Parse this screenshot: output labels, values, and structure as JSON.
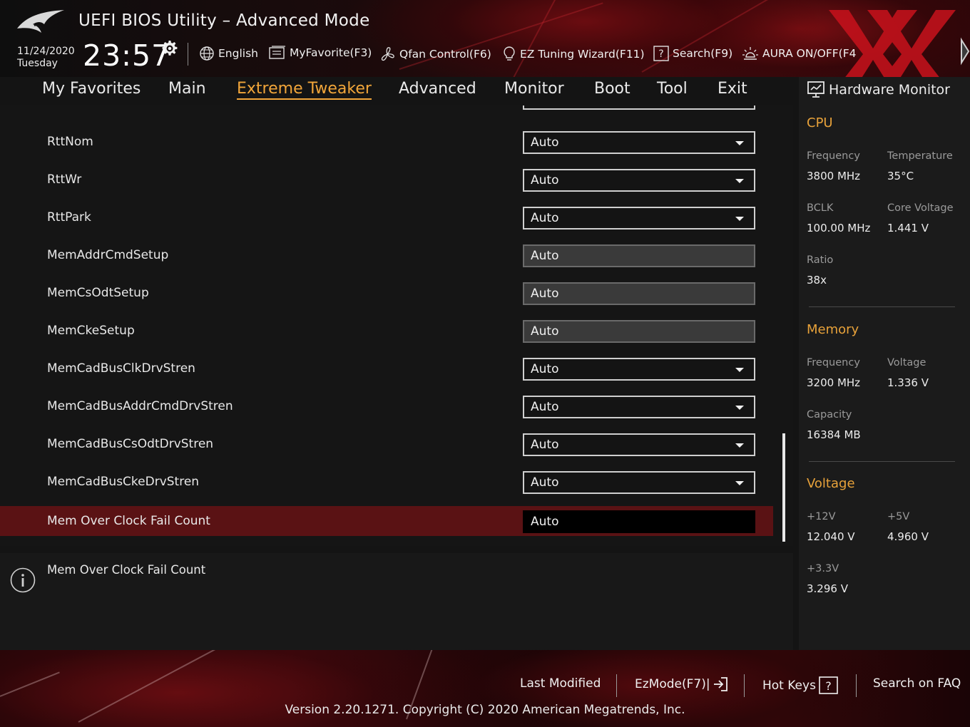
{
  "header": {
    "title": "UEFI BIOS Utility – Advanced Mode",
    "date": "11/24/2020",
    "day": "Tuesday",
    "time": "23:57",
    "toolbar": {
      "language": "English",
      "myfavorite": "MyFavorite(F3)",
      "qfan": "Qfan Control(F6)",
      "ez_tuning": "EZ Tuning Wizard(F11)",
      "search": "Search(F9)",
      "aura": "AURA ON/OFF(F4"
    }
  },
  "nav": {
    "tabs": [
      "My Favorites",
      "Main",
      "Extreme Tweaker",
      "Advanced",
      "Monitor",
      "Boot",
      "Tool",
      "Exit"
    ],
    "active": "Extreme Tweaker"
  },
  "settings": [
    {
      "label": "RttNom",
      "value": "Auto",
      "type": "dropdown"
    },
    {
      "label": "RttWr",
      "value": "Auto",
      "type": "dropdown"
    },
    {
      "label": "RttPark",
      "value": "Auto",
      "type": "dropdown"
    },
    {
      "label": "MemAddrCmdSetup",
      "value": "Auto",
      "type": "readonly"
    },
    {
      "label": "MemCsOdtSetup",
      "value": "Auto",
      "type": "readonly"
    },
    {
      "label": "MemCkeSetup",
      "value": "Auto",
      "type": "readonly"
    },
    {
      "label": "MemCadBusClkDrvStren",
      "value": "Auto",
      "type": "dropdown"
    },
    {
      "label": "MemCadBusAddrCmdDrvStren",
      "value": "Auto",
      "type": "dropdown"
    },
    {
      "label": "MemCadBusCsOdtDrvStren",
      "value": "Auto",
      "type": "dropdown"
    },
    {
      "label": "MemCadBusCkeDrvStren",
      "value": "Auto",
      "type": "dropdown"
    },
    {
      "label": "Mem Over Clock Fail Count",
      "value": "Auto",
      "type": "input",
      "selected": true
    }
  ],
  "info": {
    "text": "Mem Over Clock Fail Count"
  },
  "hw_monitor": {
    "title": "Hardware Monitor",
    "cpu": {
      "heading": "CPU",
      "frequency_label": "Frequency",
      "frequency": "3800 MHz",
      "temperature_label": "Temperature",
      "temperature": "35°C",
      "bclk_label": "BCLK",
      "bclk": "100.00 MHz",
      "core_voltage_label": "Core Voltage",
      "core_voltage": "1.441 V",
      "ratio_label": "Ratio",
      "ratio": "38x"
    },
    "memory": {
      "heading": "Memory",
      "frequency_label": "Frequency",
      "frequency": "3200 MHz",
      "voltage_label": "Voltage",
      "voltage": "1.336 V",
      "capacity_label": "Capacity",
      "capacity": "16384 MB"
    },
    "voltage": {
      "heading": "Voltage",
      "v12_label": "+12V",
      "v12": "12.040 V",
      "v5_label": "+5V",
      "v5": "4.960 V",
      "v33_label": "+3.3V",
      "v33": "3.296 V"
    }
  },
  "footer": {
    "last_modified": "Last Modified",
    "ezmode": "EzMode(F7)|",
    "hot_keys": "Hot Keys",
    "search_faq": "Search on FAQ",
    "version": "Version 2.20.1271. Copyright (C) 2020 American Megatrends, Inc."
  },
  "colors": {
    "accent": "#f2a63a",
    "selected_row": "#5a1214",
    "brand_red": "#b5121b"
  }
}
